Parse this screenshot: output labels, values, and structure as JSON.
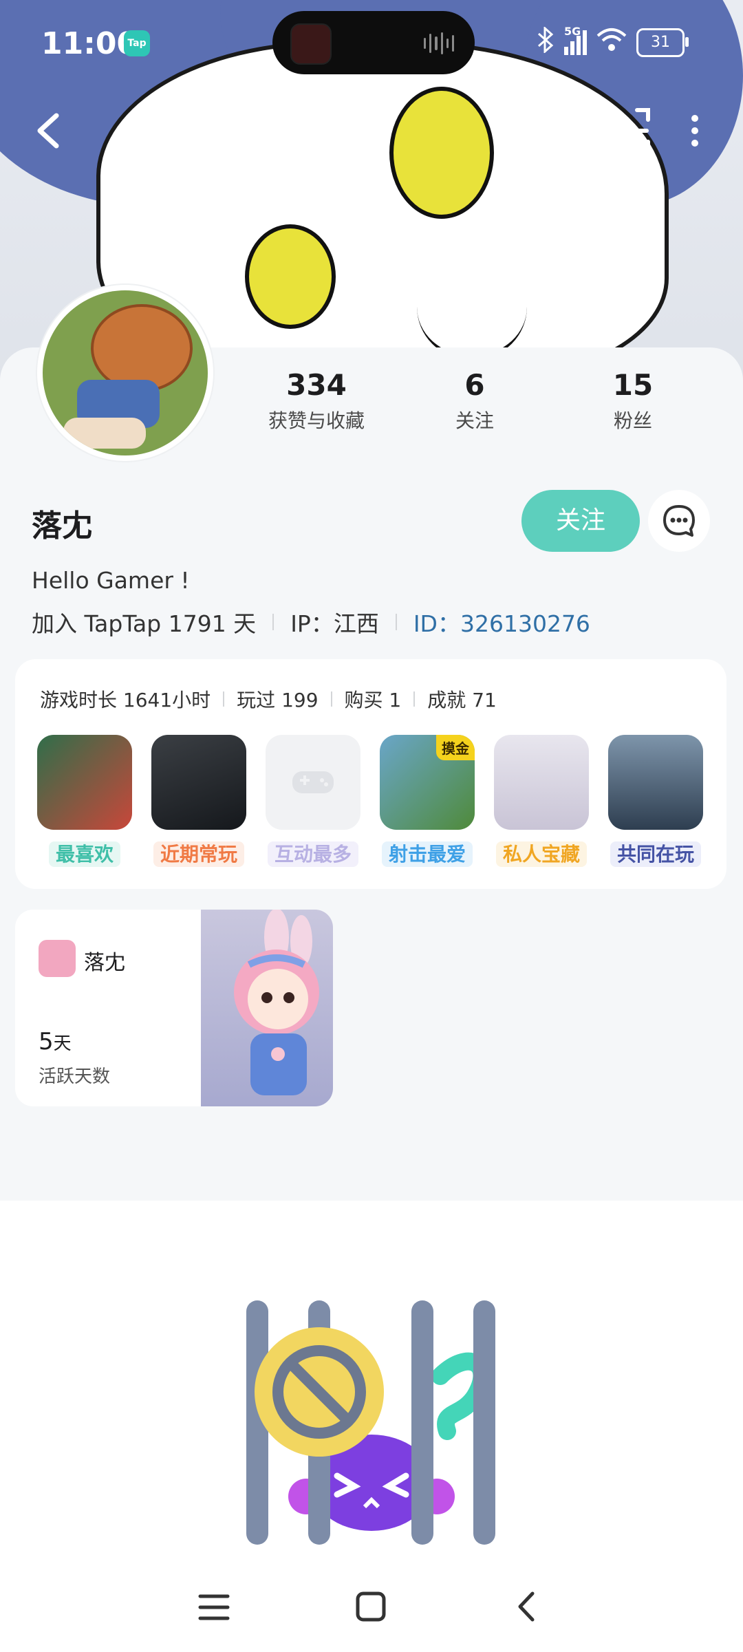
{
  "status_bar": {
    "time": "11:00",
    "app_badge": "Tap",
    "network": "5G",
    "battery": "31"
  },
  "profile": {
    "stats": [
      {
        "value": "334",
        "label": "获赞与收藏"
      },
      {
        "value": "6",
        "label": "关注"
      },
      {
        "value": "15",
        "label": "粉丝"
      }
    ],
    "name": "落冘",
    "follow_label": "关注",
    "bio": "Hello Gamer !",
    "join_text": "加入 TapTap 1791 天",
    "ip_text": "IP：江西",
    "id_text": "ID：326130276"
  },
  "games": {
    "stats": [
      "游戏时长 1641小时",
      "玩过 199",
      "购买 1",
      "成就 71"
    ],
    "tiles": [
      {
        "label": "最喜欢",
        "color": "#3fbfa8",
        "bg": "#e6f7f3"
      },
      {
        "label": "近期常玩",
        "color": "#f07a45",
        "bg": "#fdeee6"
      },
      {
        "label": "互动最多",
        "color": "#b7b0e3",
        "bg": "#f2f0fb"
      },
      {
        "label": "射击最爱",
        "color": "#3ea0e6",
        "bg": "#e6f3fc"
      },
      {
        "label": "私人宝藏",
        "color": "#f0a623",
        "bg": "#fdf4e2"
      },
      {
        "label": "共同在玩",
        "color": "#4553a5",
        "bg": "#eceefa"
      }
    ],
    "badge": "摸金"
  },
  "active_card": {
    "name": "落冘",
    "days": "5",
    "days_unit": "天",
    "label": "活跃天数"
  }
}
